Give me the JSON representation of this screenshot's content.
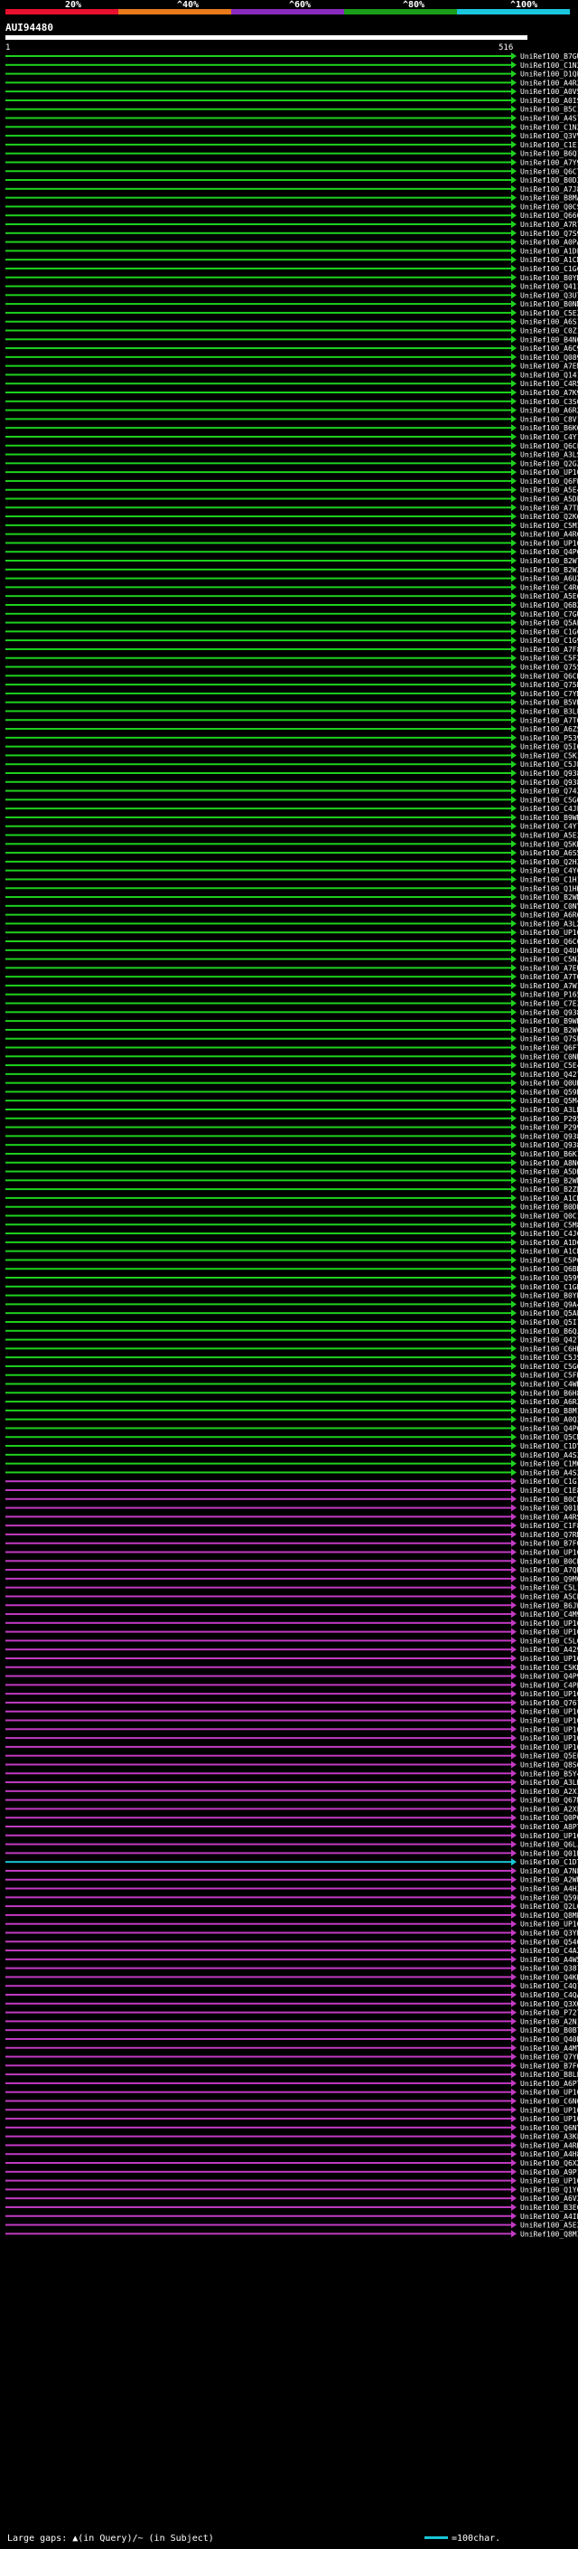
{
  "scale": {
    "ticks": [
      "20%",
      "^40%",
      "^60%",
      "^80%",
      "^100%"
    ],
    "colors": [
      "#e8102e",
      "#e87a1a",
      "#8a2bbf",
      "#1a9e1a",
      "#19c6dc"
    ]
  },
  "query": {
    "id": "AUI94480",
    "start_label": "1",
    "end_label": "516"
  },
  "colors": {
    "green": "#1ed21e",
    "purple": "#c23ac2",
    "cyan": "#18c6d6",
    "white": "#ffffff"
  },
  "hits": [
    {
      "label": "UniRef100_B7GUT6",
      "color": "green"
    },
    {
      "label": "UniRef100_C1N2U9",
      "color": "green"
    },
    {
      "label": "UniRef100_D1QL6",
      "color": "green"
    },
    {
      "label": "UniRef100_A4R293",
      "color": "green"
    },
    {
      "label": "UniRef100_A0V5F0",
      "color": "green"
    },
    {
      "label": "UniRef100_A0IS21",
      "color": "green"
    },
    {
      "label": "UniRef100_B5C1A6",
      "color": "green"
    },
    {
      "label": "UniRef100_A4S749",
      "color": "green"
    },
    {
      "label": "UniRef100_C1N2F7",
      "color": "green"
    },
    {
      "label": "UniRef100_Q3VVE5",
      "color": "green"
    },
    {
      "label": "UniRef100_C1E1H6",
      "color": "green"
    },
    {
      "label": "UniRef100_B6Q1Q7",
      "color": "green"
    },
    {
      "label": "UniRef100_A7Y9C2",
      "color": "green"
    },
    {
      "label": "UniRef100_Q6CT19",
      "color": "green"
    },
    {
      "label": "UniRef100_B0D349",
      "color": "green"
    },
    {
      "label": "UniRef100_A7J887",
      "color": "green"
    },
    {
      "label": "UniRef100_B8MA83",
      "color": "green"
    },
    {
      "label": "UniRef100_Q0CS52",
      "color": "green"
    },
    {
      "label": "UniRef100_Q66093",
      "color": "green"
    },
    {
      "label": "UniRef100_A7R7P1",
      "color": "green"
    },
    {
      "label": "UniRef100_Q7S9Z6",
      "color": "green"
    },
    {
      "label": "UniRef100_A0PA44",
      "color": "green"
    },
    {
      "label": "UniRef100_A1DL J6",
      "color": "green"
    },
    {
      "label": "UniRef100_A1CMH2",
      "color": "green"
    },
    {
      "label": "UniRef100_C1GC30",
      "color": "green"
    },
    {
      "label": "UniRef100_B0YD90",
      "color": "green"
    },
    {
      "label": "UniRef100_Q41148",
      "color": "green"
    },
    {
      "label": "UniRef100_Q3UTW2",
      "color": "green"
    },
    {
      "label": "UniRef100_B0NMM5",
      "color": "green"
    },
    {
      "label": "UniRef100_C5E2N2",
      "color": "green"
    },
    {
      "label": "UniRef100_A6S199",
      "color": "green"
    },
    {
      "label": "UniRef100_C0Z1F3",
      "color": "green"
    },
    {
      "label": "UniRef100_B4N020",
      "color": "green"
    },
    {
      "label": "UniRef100_A6C9Z9",
      "color": "green"
    },
    {
      "label": "UniRef100_Q08972",
      "color": "green"
    },
    {
      "label": "UniRef100_A7EMM5",
      "color": "green"
    },
    {
      "label": "UniRef100_Q14134",
      "color": "green"
    },
    {
      "label": "UniRef100_C4R5E1",
      "color": "green"
    },
    {
      "label": "UniRef100_A7K9T9",
      "color": "green"
    },
    {
      "label": "UniRef100_C3S045",
      "color": "green"
    },
    {
      "label": "UniRef100_A6R245",
      "color": "green"
    },
    {
      "label": "UniRef100_C8V1D8",
      "color": "green"
    },
    {
      "label": "UniRef100_B6K0Y6",
      "color": "green"
    },
    {
      "label": "UniRef100_C4Y1W2",
      "color": "green"
    },
    {
      "label": "UniRef100_Q6CFS2",
      "color": "green"
    },
    {
      "label": "UniRef100_A3LS42",
      "color": "green"
    },
    {
      "label": "UniRef100_Q2GZS2",
      "color": "green"
    },
    {
      "label": "UniRef100_UP1000...",
      "color": "green"
    },
    {
      "label": "UniRef100_Q6FW59",
      "color": "green"
    },
    {
      "label": "UniRef100_A5E4P0",
      "color": "green"
    },
    {
      "label": "UniRef100_A5DE97",
      "color": "green"
    },
    {
      "label": "UniRef100_A7TE61",
      "color": "green"
    },
    {
      "label": "UniRef100_Q2K6Q0",
      "color": "green"
    },
    {
      "label": "UniRef100_C5M1M8",
      "color": "green"
    },
    {
      "label": "UniRef100_A4RC19",
      "color": "green"
    },
    {
      "label": "UniRef100_UP1000...",
      "color": "green"
    },
    {
      "label": "UniRef100_Q4P6W1",
      "color": "green"
    },
    {
      "label": "UniRef100_B2W7Q4",
      "color": "green"
    },
    {
      "label": "UniRef100_B2W3M5",
      "color": "green"
    },
    {
      "label": "UniRef100_A6UX56",
      "color": "green"
    },
    {
      "label": "UniRef100_C4R6N9",
      "color": "green"
    },
    {
      "label": "UniRef100_A5E6Y1",
      "color": "green"
    },
    {
      "label": "UniRef100_Q6B2H3",
      "color": "green"
    },
    {
      "label": "UniRef100_C7GUG7",
      "color": "green"
    },
    {
      "label": "UniRef100_Q5AP52",
      "color": "green"
    },
    {
      "label": "UniRef100_C1GC16",
      "color": "green"
    },
    {
      "label": "UniRef100_C1G9Y5",
      "color": "green"
    },
    {
      "label": "UniRef100_A7F8W2",
      "color": "green"
    },
    {
      "label": "UniRef100_C5FXQ1",
      "color": "green"
    },
    {
      "label": "UniRef100_Q755F4",
      "color": "green"
    },
    {
      "label": "UniRef100_Q6CKW7",
      "color": "green"
    },
    {
      "label": "UniRef100_Q75N29",
      "color": "green"
    },
    {
      "label": "UniRef100_C7YML4",
      "color": "green"
    },
    {
      "label": "UniRef100_B5VR21",
      "color": "green"
    },
    {
      "label": "UniRef100_B3LPP9",
      "color": "green"
    },
    {
      "label": "UniRef100_A7TQ08",
      "color": "green"
    },
    {
      "label": "UniRef100_A6ZS63",
      "color": "green"
    },
    {
      "label": "UniRef100_P53976",
      "color": "green"
    },
    {
      "label": "UniRef100_Q5IQE4",
      "color": "green"
    },
    {
      "label": "UniRef100_C5K1M6",
      "color": "green"
    },
    {
      "label": "UniRef100_C5JLP2",
      "color": "green"
    },
    {
      "label": "UniRef100_Q93813",
      "color": "green"
    },
    {
      "label": "UniRef100_Q93814",
      "color": "green"
    },
    {
      "label": "UniRef100_Q74257",
      "color": "green"
    },
    {
      "label": "UniRef100_C5GQB9",
      "color": "green"
    },
    {
      "label": "UniRef100_C4JL87",
      "color": "green"
    },
    {
      "label": "UniRef100_B9WMX0",
      "color": "green"
    },
    {
      "label": "UniRef100_C4Y7S6",
      "color": "green"
    },
    {
      "label": "UniRef100_A5E2I6",
      "color": "green"
    },
    {
      "label": "UniRef100_Q5KD02",
      "color": "green"
    },
    {
      "label": "UniRef100_A6S509",
      "color": "green"
    },
    {
      "label": "UniRef100_Q2H3M2",
      "color": "green"
    },
    {
      "label": "UniRef100_C4YC28",
      "color": "green"
    },
    {
      "label": "UniRef100_C1H1A4",
      "color": "green"
    },
    {
      "label": "UniRef100_Q1HK44",
      "color": "green"
    },
    {
      "label": "UniRef100_B2WMC7",
      "color": "green"
    },
    {
      "label": "UniRef100_C0NYE7",
      "color": "green"
    },
    {
      "label": "UniRef100_A6R630",
      "color": "green"
    },
    {
      "label": "UniRef100_A3LX00",
      "color": "green"
    },
    {
      "label": "UniRef100_UP1000...",
      "color": "green"
    },
    {
      "label": "UniRef100_Q6C6I7",
      "color": "green"
    },
    {
      "label": "UniRef100_Q4UQV3",
      "color": "green"
    },
    {
      "label": "UniRef100_C5NZV9",
      "color": "green"
    },
    {
      "label": "UniRef100_A7EUB4",
      "color": "green"
    },
    {
      "label": "UniRef100_A7TGW4",
      "color": "green"
    },
    {
      "label": "UniRef100_A7W1Q2",
      "color": "green"
    },
    {
      "label": "UniRef100_P16521",
      "color": "green"
    },
    {
      "label": "UniRef100_C7E3B2",
      "color": "green"
    },
    {
      "label": "UniRef100_Q93810",
      "color": "green"
    },
    {
      "label": "UniRef100_B9WH19",
      "color": "green"
    },
    {
      "label": "UniRef100_B2WCK4",
      "color": "green"
    },
    {
      "label": "UniRef100_Q7SEV6",
      "color": "green"
    },
    {
      "label": "UniRef100_Q6FT22",
      "color": "green"
    },
    {
      "label": "UniRef100_C0NMP8",
      "color": "green"
    },
    {
      "label": "UniRef100_C5E4D9",
      "color": "green"
    },
    {
      "label": "UniRef100_Q42765",
      "color": "green"
    },
    {
      "label": "UniRef100_Q0UK18",
      "color": "green"
    },
    {
      "label": "UniRef100_Q59N09",
      "color": "green"
    },
    {
      "label": "UniRef100_Q5M4Q0",
      "color": "green"
    },
    {
      "label": "UniRef100_A3LR46",
      "color": "green"
    },
    {
      "label": "UniRef100_P29551",
      "color": "green"
    },
    {
      "label": "UniRef100_P29997",
      "color": "green"
    },
    {
      "label": "UniRef100_Q93812",
      "color": "green"
    },
    {
      "label": "UniRef100_Q93811",
      "color": "green"
    },
    {
      "label": "UniRef100_B6K119",
      "color": "green"
    },
    {
      "label": "UniRef100_A8N6R2",
      "color": "green"
    },
    {
      "label": "UniRef100_A5DDF1",
      "color": "green"
    },
    {
      "label": "UniRef100_B2WMM5",
      "color": "green"
    },
    {
      "label": "UniRef100_B2ZE73",
      "color": "green"
    },
    {
      "label": "UniRef100_A1CDP0",
      "color": "green"
    },
    {
      "label": "UniRef100_B0DKX3",
      "color": "green"
    },
    {
      "label": "UniRef100_Q0C1M1",
      "color": "green"
    },
    {
      "label": "UniRef100_C5M8F6",
      "color": "green"
    },
    {
      "label": "UniRef100_C4JCT7",
      "color": "green"
    },
    {
      "label": "UniRef100_A1DC07",
      "color": "green"
    },
    {
      "label": "UniRef100_A1CN36",
      "color": "green"
    },
    {
      "label": "UniRef100_C5PC43",
      "color": "green"
    },
    {
      "label": "UniRef100_Q6BK70",
      "color": "green"
    },
    {
      "label": "UniRef100_Q59905",
      "color": "green"
    },
    {
      "label": "UniRef100_C1GND5",
      "color": "green"
    },
    {
      "label": "UniRef100_B0YB17",
      "color": "green"
    },
    {
      "label": "UniRef100_Q9A489",
      "color": "green"
    },
    {
      "label": "UniRef100_Q5AEN1",
      "color": "green"
    },
    {
      "label": "UniRef100_Q5I1N7",
      "color": "green"
    },
    {
      "label": "UniRef100_B6QJR0",
      "color": "green"
    },
    {
      "label": "UniRef100_Q42734",
      "color": "green"
    },
    {
      "label": "UniRef100_C6HK18",
      "color": "green"
    },
    {
      "label": "UniRef100_C5JSQ0",
      "color": "green"
    },
    {
      "label": "UniRef100_C5GQP8",
      "color": "green"
    },
    {
      "label": "UniRef100_C5FN09",
      "color": "green"
    },
    {
      "label": "UniRef100_C4WKZ6",
      "color": "green"
    },
    {
      "label": "UniRef100_B6H8F7",
      "color": "green"
    },
    {
      "label": "UniRef100_A6R2Y5",
      "color": "green"
    },
    {
      "label": "UniRef100_B8M1V4",
      "color": "green"
    },
    {
      "label": "UniRef100_A0Q339",
      "color": "green"
    },
    {
      "label": "UniRef100_Q4P6L0",
      "color": "green"
    },
    {
      "label": "UniRef100_Q5CMW1",
      "color": "green"
    },
    {
      "label": "UniRef100_C1DYC6",
      "color": "green"
    },
    {
      "label": "UniRef100_A4S3Y8",
      "color": "green"
    },
    {
      "label": "UniRef100_C1MQP0",
      "color": "green"
    },
    {
      "label": "UniRef100_A4S3I0",
      "color": "green"
    },
    {
      "label": "UniRef100_C1G1Z3",
      "color": "purple"
    },
    {
      "label": "UniRef100_C1E8L4",
      "color": "purple"
    },
    {
      "label": "UniRef100_B0CEB9",
      "color": "purple"
    },
    {
      "label": "UniRef100_Q01EK5",
      "color": "purple"
    },
    {
      "label": "UniRef100_A4RSH8",
      "color": "purple"
    },
    {
      "label": "UniRef100_C1F8L1",
      "color": "purple"
    },
    {
      "label": "UniRef100_Q7RMW7",
      "color": "purple"
    },
    {
      "label": "UniRef100_B7FQ66",
      "color": "purple"
    },
    {
      "label": "UniRef100_UP1000...",
      "color": "purple"
    },
    {
      "label": "UniRef100_B0CB70",
      "color": "purple"
    },
    {
      "label": "UniRef100_A7QN00",
      "color": "purple"
    },
    {
      "label": "UniRef100_Q9M0L4",
      "color": "purple"
    },
    {
      "label": "UniRef100_C5L1K3",
      "color": "purple"
    },
    {
      "label": "UniRef100_A5CP36",
      "color": "purple"
    },
    {
      "label": "UniRef100_B6JW30",
      "color": "purple"
    },
    {
      "label": "UniRef100_C4M9P3",
      "color": "purple"
    },
    {
      "label": "UniRef100_UP1000...",
      "color": "purple"
    },
    {
      "label": "UniRef100_UP1000...",
      "color": "purple"
    },
    {
      "label": "UniRef100_C5L6W5",
      "color": "purple"
    },
    {
      "label": "UniRef100_A42943",
      "color": "purple"
    },
    {
      "label": "UniRef100_UP1000...",
      "color": "purple"
    },
    {
      "label": "UniRef100_C5KRC3",
      "color": "purple"
    },
    {
      "label": "UniRef100_Q4P9X8",
      "color": "purple"
    },
    {
      "label": "UniRef100_C4PEX2",
      "color": "purple"
    },
    {
      "label": "UniRef100_UP1000...",
      "color": "purple"
    },
    {
      "label": "UniRef100_Q767L0",
      "color": "purple"
    },
    {
      "label": "UniRef100_UP1000...",
      "color": "purple"
    },
    {
      "label": "UniRef100_UP1000...",
      "color": "purple"
    },
    {
      "label": "UniRef100_UP1000...",
      "color": "purple"
    },
    {
      "label": "UniRef100_UP1000...",
      "color": "purple"
    },
    {
      "label": "UniRef100_UP1000...",
      "color": "purple"
    },
    {
      "label": "UniRef100_Q5EL55",
      "color": "purple"
    },
    {
      "label": "UniRef100_Q8S694",
      "color": "purple"
    },
    {
      "label": "UniRef100_B5Y4C4",
      "color": "purple"
    },
    {
      "label": "UniRef100_A3LH62",
      "color": "purple"
    },
    {
      "label": "UniRef100_A2X1E7",
      "color": "purple"
    },
    {
      "label": "UniRef100_Q67M60",
      "color": "purple"
    },
    {
      "label": "UniRef100_A2XFZ3",
      "color": "purple"
    },
    {
      "label": "UniRef100_Q0P6Q8",
      "color": "purple"
    },
    {
      "label": "UniRef100_A8PTN2",
      "color": "purple"
    },
    {
      "label": "UniRef100_UP1000...",
      "color": "purple"
    },
    {
      "label": "UniRef100_Q6LJ73",
      "color": "purple"
    },
    {
      "label": "UniRef100_Q01B29",
      "color": "purple"
    },
    {
      "label": "UniRef100_C1DTY7",
      "color": "cyan"
    },
    {
      "label": "UniRef100_A7NE14",
      "color": "purple"
    },
    {
      "label": "UniRef100_A2WNF4",
      "color": "purple"
    },
    {
      "label": "UniRef100_A4H318",
      "color": "purple"
    },
    {
      "label": "UniRef100_Q59F36",
      "color": "purple"
    },
    {
      "label": "UniRef100_Q2L612",
      "color": "purple"
    },
    {
      "label": "UniRef100_Q8ME71",
      "color": "purple"
    },
    {
      "label": "UniRef100_UP1000...",
      "color": "purple"
    },
    {
      "label": "UniRef100_Q3YBZ5",
      "color": "purple"
    },
    {
      "label": "UniRef100_Q54Q5Q",
      "color": "purple"
    },
    {
      "label": "UniRef100_C4A223",
      "color": "purple"
    },
    {
      "label": "UniRef100_A4W542",
      "color": "purple"
    },
    {
      "label": "UniRef100_Q387W0",
      "color": "purple"
    },
    {
      "label": "UniRef100_Q4KKN6",
      "color": "purple"
    },
    {
      "label": "UniRef100_C4Q135",
      "color": "purple"
    },
    {
      "label": "UniRef100_C4QAJ5",
      "color": "purple"
    },
    {
      "label": "UniRef100_Q3XQZ2",
      "color": "purple"
    },
    {
      "label": "UniRef100_P72759",
      "color": "purple"
    },
    {
      "label": "UniRef100_A2N1B1",
      "color": "purple"
    },
    {
      "label": "UniRef100_B0BTZ0",
      "color": "purple"
    },
    {
      "label": "UniRef100_Q40DE1",
      "color": "purple"
    },
    {
      "label": "UniRef100_A4MY00",
      "color": "purple"
    },
    {
      "label": "UniRef100_Q7YK37",
      "color": "purple"
    },
    {
      "label": "UniRef100_B7FQR2",
      "color": "purple"
    },
    {
      "label": "UniRef100_B8LPV8",
      "color": "purple"
    },
    {
      "label": "UniRef100_A6PTJ0",
      "color": "purple"
    },
    {
      "label": "UniRef100_UP1000...",
      "color": "purple"
    },
    {
      "label": "UniRef100_C6N016",
      "color": "purple"
    },
    {
      "label": "UniRef100_UP1000...",
      "color": "purple"
    },
    {
      "label": "UniRef100_UP1000...",
      "color": "purple"
    },
    {
      "label": "UniRef100_Q6NY15",
      "color": "purple"
    },
    {
      "label": "UniRef100_A3KFZ3",
      "color": "purple"
    },
    {
      "label": "UniRef100_A4RHP8",
      "color": "purple"
    },
    {
      "label": "UniRef100_A4H8Q7",
      "color": "purple"
    },
    {
      "label": "UniRef100_Q6XXX3",
      "color": "purple"
    },
    {
      "label": "UniRef100_A9P134",
      "color": "purple"
    },
    {
      "label": "UniRef100_UP1000...",
      "color": "purple"
    },
    {
      "label": "UniRef100_Q1YG58",
      "color": "purple"
    },
    {
      "label": "UniRef100_A6V2L9",
      "color": "purple"
    },
    {
      "label": "UniRef100_B3E019",
      "color": "purple"
    },
    {
      "label": "UniRef100_A4IBR8",
      "color": "purple"
    },
    {
      "label": "UniRef100_A5E2S7",
      "color": "purple"
    },
    {
      "label": "UniRef100_Q8MI19",
      "color": "purple"
    }
  ],
  "footer": {
    "large_gaps_text": "Large gaps: ▲(in Query)/~ (in Subject)",
    "scale_text": "=100char."
  }
}
